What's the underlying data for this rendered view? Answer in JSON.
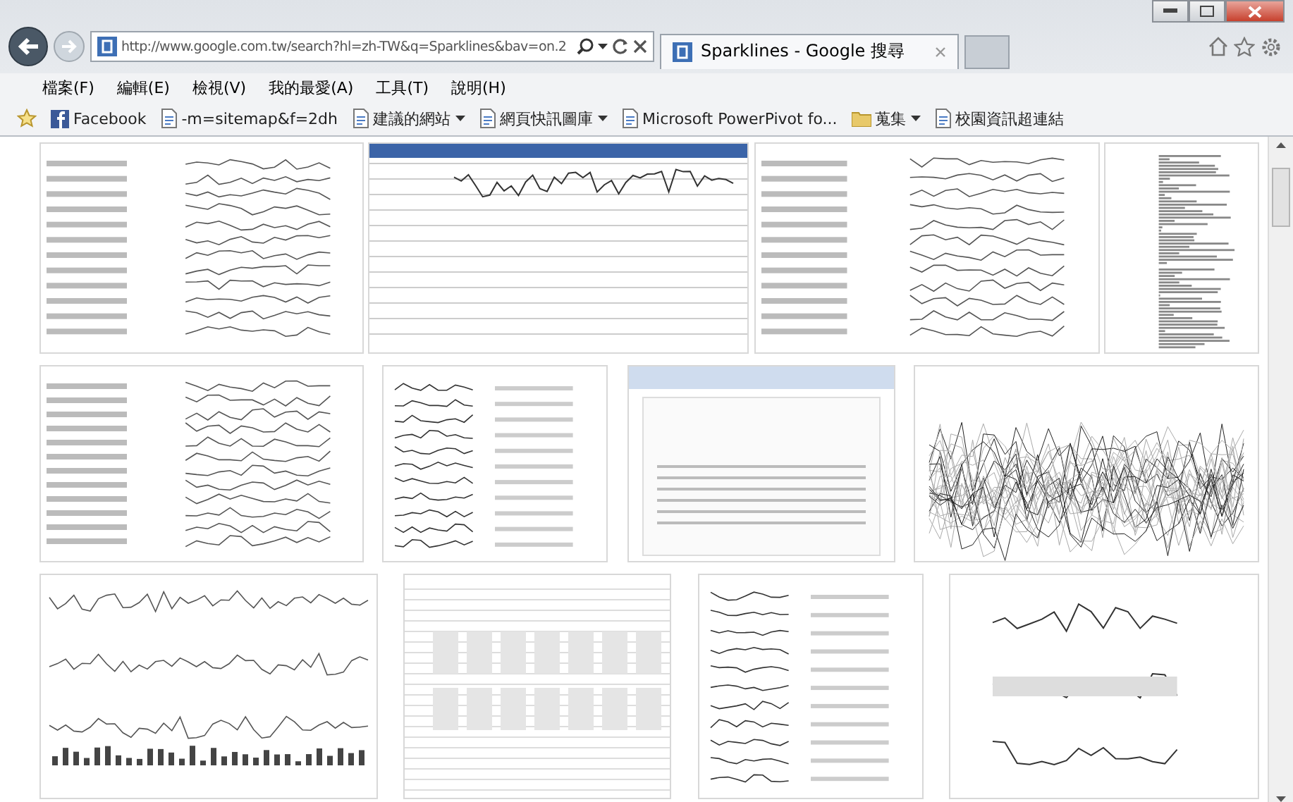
{
  "address_bar": {
    "url": "http://www.google.com.tw/search?hl=zh-TW&q=Sparklines&bav=on.2"
  },
  "tabs": [
    {
      "label": "Sparklines - Google 搜尋",
      "selected": true
    }
  ],
  "menu": [
    "檔案(F)",
    "編輯(E)",
    "檢視(V)",
    "我的最愛(A)",
    "工具(T)",
    "說明(H)"
  ],
  "favorites": [
    {
      "label": "Facebook",
      "kind": "site",
      "dropdown": false
    },
    {
      "label": "-m=sitemap&f=2dh",
      "kind": "page",
      "dropdown": false
    },
    {
      "label": "建議的網站",
      "kind": "page",
      "dropdown": true
    },
    {
      "label": "網頁快訊圖庫",
      "kind": "page",
      "dropdown": true
    },
    {
      "label": "Microsoft PowerPivot fo...",
      "kind": "page",
      "dropdown": false
    },
    {
      "label": "蒐集",
      "kind": "folder",
      "dropdown": true
    },
    {
      "label": "校園資訊超連結",
      "kind": "page",
      "dropdown": false
    }
  ],
  "results": [
    {
      "thumbnails": [
        {
          "kind": "table"
        },
        {
          "kind": "window"
        },
        {
          "kind": "line-table"
        },
        {
          "kind": "bar-strip"
        }
      ]
    },
    {
      "thumbnails": [
        {
          "kind": "table"
        },
        {
          "kind": "list"
        },
        {
          "kind": "document"
        },
        {
          "kind": "line-chart"
        }
      ]
    },
    {
      "thumbnails": [
        {
          "kind": "grid"
        },
        {
          "kind": "spreadsheet"
        },
        {
          "kind": "list"
        },
        {
          "kind": "annotated"
        }
      ]
    }
  ]
}
